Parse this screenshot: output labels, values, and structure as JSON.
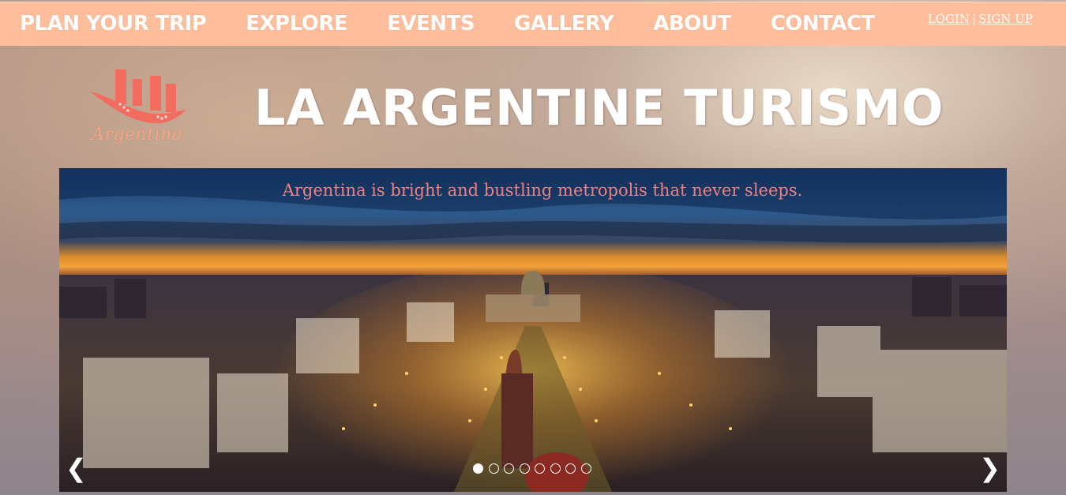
{
  "nav": {
    "items": [
      {
        "label": "PLAN YOUR TRIP"
      },
      {
        "label": "EXPLORE"
      },
      {
        "label": "EVENTS"
      },
      {
        "label": "GALLERY"
      },
      {
        "label": "ABOUT"
      },
      {
        "label": "CONTACT"
      }
    ],
    "login_label": "LOGIN",
    "separator": "|",
    "signup_label": "SIGN UP"
  },
  "header": {
    "logo_text": "Argentina",
    "site_title": "LA ARGENTINE TURISMO"
  },
  "slider": {
    "caption": "Argentina is bright and bustling metropolis that never sleeps.",
    "prev_label": "❮",
    "next_label": "❯",
    "slide_count": 8,
    "active_slide": 1
  },
  "colors": {
    "nav_bg": "#ffbe9b",
    "caption": "#f08080",
    "logo_accent": "#f26d5f"
  },
  "icons": [
    "argentina-logo-icon",
    "chevron-left-icon",
    "chevron-right-icon"
  ]
}
